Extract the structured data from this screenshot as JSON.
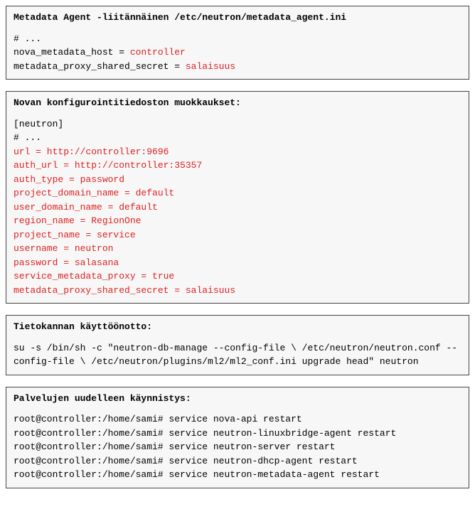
{
  "blocks": {
    "metadata_agent": {
      "title": "Metadata Agent -liitännäinen /etc/neutron/metadata_agent.ini",
      "comment": "# ...",
      "line1_prefix": "nova_metadata_host = ",
      "line1_value": "controller",
      "line2_prefix": "metadata_proxy_shared_secret = ",
      "line2_value": "salaisuus"
    },
    "nova_conf": {
      "title": "Novan konfigurointitiedoston muokkaukset:",
      "section": "[neutron]",
      "comment": "# ...",
      "lines": [
        "url = http://controller:9696",
        "auth_url = http://controller:35357",
        "auth_type = password",
        "project_domain_name = default",
        "user_domain_name = default",
        "region_name = RegionOne",
        "project_name = service",
        "username = neutron",
        "password = salasana",
        "service_metadata_proxy = true",
        "metadata_proxy_shared_secret = salaisuus"
      ]
    },
    "db": {
      "title": "Tietokannan käyttöönotto:",
      "cmd": "su -s /bin/sh -c \"neutron-db-manage --config-file \\ /etc/neutron/neutron.conf --config-file \\ /etc/neutron/plugins/ml2/ml2_conf.ini upgrade head\" neutron"
    },
    "restart": {
      "title": "Palvelujen uudelleen käynnistys:",
      "lines": [
        "root@controller:/home/sami# service nova-api restart",
        "root@controller:/home/sami# service neutron-linuxbridge-agent restart",
        "root@controller:/home/sami# service neutron-server restart",
        "root@controller:/home/sami# service neutron-dhcp-agent restart",
        "root@controller:/home/sami# service neutron-metadata-agent restart"
      ]
    }
  }
}
